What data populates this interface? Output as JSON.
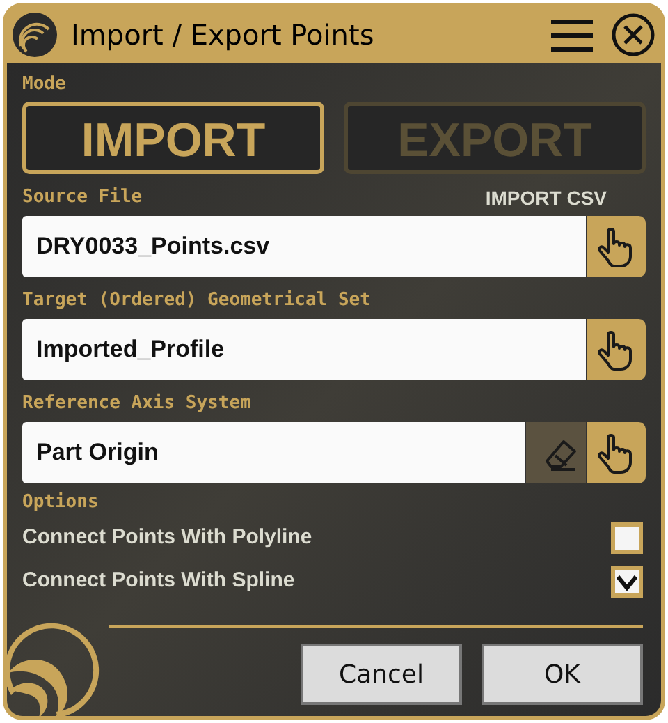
{
  "window": {
    "title": "Import / Export Points"
  },
  "mode": {
    "label": "Mode",
    "options": [
      {
        "label": "IMPORT",
        "selected": true
      },
      {
        "label": "EXPORT",
        "selected": false
      }
    ]
  },
  "fields": [
    {
      "label": "Source File",
      "note": "IMPORT CSV",
      "value": "DRY0033_Points.csv",
      "actions": [
        {
          "kind": "pick"
        }
      ]
    },
    {
      "label": "Target (Ordered) Geometrical Set",
      "value": "Imported_Profile",
      "actions": [
        {
          "kind": "pick"
        }
      ]
    },
    {
      "label": "Reference Axis System",
      "value": "Part Origin",
      "actions": [
        {
          "kind": "clear"
        },
        {
          "kind": "pick"
        }
      ]
    }
  ],
  "options": {
    "label": "Options",
    "items": [
      {
        "label": "Connect Points With Polyline",
        "checked": false
      },
      {
        "label": "Connect Points With Spline",
        "checked": true
      }
    ]
  },
  "buttons": [
    "Cancel",
    "OK"
  ]
}
